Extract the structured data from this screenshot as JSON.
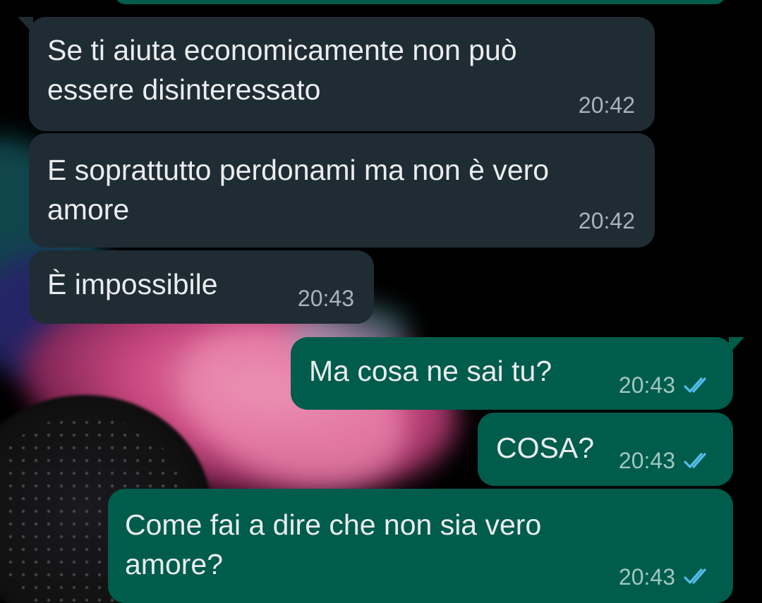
{
  "colors": {
    "incoming_bubble": "#202c33",
    "outgoing_bubble": "#005c4b",
    "message_text": "#e9edef",
    "timestamp": "#a6b4bb",
    "read_ticks": "#53bdeb"
  },
  "messages": [
    {
      "direction": "incoming",
      "lines": [
        "Se ti aiuta economicamente non può",
        "essere disinteressato"
      ],
      "time": "20:42"
    },
    {
      "direction": "incoming",
      "lines": [
        "E soprattutto perdonami ma non è vero",
        "amore"
      ],
      "time": "20:42"
    },
    {
      "direction": "incoming",
      "lines": [
        "È impossibile"
      ],
      "time": "20:43"
    },
    {
      "direction": "outgoing",
      "lines": [
        "Ma cosa ne sai tu?"
      ],
      "time": "20:43",
      "status_icon": "double-check-read-icon"
    },
    {
      "direction": "outgoing",
      "lines": [
        "COSA?"
      ],
      "time": "20:43",
      "status_icon": "double-check-read-icon"
    },
    {
      "direction": "outgoing",
      "lines": [
        "Come fai a dire che non sia vero",
        "amore?"
      ],
      "time": "20:43",
      "status_icon": "double-check-read-icon"
    }
  ]
}
